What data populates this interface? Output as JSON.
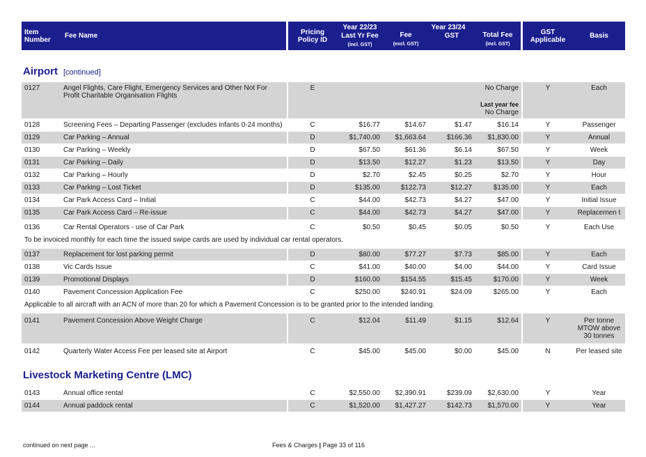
{
  "header": {
    "item_number": "Item Number",
    "fee_name": "Fee Name",
    "pricing_policy": "Pricing Policy ID",
    "year_2223": "Year 22/23",
    "last_yr_fee": "Last Yr Fee",
    "incl_gst_1": "(incl. GST)",
    "year_2324": "Year 23/24",
    "fee": "Fee",
    "excl_gst": "(excl. GST)",
    "gst": "GST",
    "total_fee": "Total Fee",
    "incl_gst_2": "(incl. GST)",
    "gst_applicable": "GST Applicable",
    "basis": "Basis"
  },
  "sections": {
    "airport": {
      "title": "Airport",
      "continued": "[continued]",
      "rows": [
        {
          "item": "0127",
          "name": "Angel Flights, Care Flight, Emergency Services and Other Not For Profit Charitable Organisation Flights",
          "policy": "E",
          "last": "",
          "fee": "",
          "gst": "",
          "total": "No Charge",
          "total_note_label": "Last year fee",
          "total_note_value": "No Charge",
          "applicable": "Y",
          "basis": "Each"
        },
        {
          "item": "0128",
          "name": "Screening Fees – Departing Passenger (excludes infants 0-24 months)",
          "policy": "C",
          "last": "$16.77",
          "fee": "$14.67",
          "gst": "$1.47",
          "total": "$16.14",
          "applicable": "Y",
          "basis": "Passenger"
        },
        {
          "item": "0129",
          "name": "Car Parking – Annual",
          "policy": "D",
          "last": "$1,740.00",
          "fee": "$1,663.64",
          "gst": "$166.36",
          "total": "$1,830.00",
          "applicable": "Y",
          "basis": "Annual"
        },
        {
          "item": "0130",
          "name": "Car Parking – Weekly",
          "policy": "D",
          "last": "$67.50",
          "fee": "$61.36",
          "gst": "$6.14",
          "total": "$67.50",
          "applicable": "Y",
          "basis": "Week"
        },
        {
          "item": "0131",
          "name": "Car Parking – Daily",
          "policy": "D",
          "last": "$13.50",
          "fee": "$12.27",
          "gst": "$1.23",
          "total": "$13.50",
          "applicable": "Y",
          "basis": "Day"
        },
        {
          "item": "0132",
          "name": "Car Parking – Hourly",
          "policy": "D",
          "last": "$2.70",
          "fee": "$2.45",
          "gst": "$0.25",
          "total": "$2.70",
          "applicable": "Y",
          "basis": "Hour"
        },
        {
          "item": "0133",
          "name": "Car Parking – Lost Ticket",
          "policy": "D",
          "last": "$135.00",
          "fee": "$122.73",
          "gst": "$12.27",
          "total": "$135.00",
          "applicable": "Y",
          "basis": "Each"
        },
        {
          "item": "0134",
          "name": "Car Park Access Card – Initial",
          "policy": "C",
          "last": "$44.00",
          "fee": "$42.73",
          "gst": "$4.27",
          "total": "$47.00",
          "applicable": "Y",
          "basis": "Initial Issue"
        },
        {
          "item": "0135",
          "name": "Car Park Access Card – Re-issue",
          "policy": "C",
          "last": "$44.00",
          "fee": "$42.73",
          "gst": "$4.27",
          "total": "$47.00",
          "applicable": "Y",
          "basis": "Replacemen t"
        },
        {
          "item": "0136",
          "name": "Car Rental Operators - use of Car Park",
          "policy": "C",
          "last": "$0.50",
          "fee": "$0.45",
          "gst": "$0.05",
          "total": "$0.50",
          "applicable": "Y",
          "basis": "Each Use"
        },
        {
          "item": "0137",
          "name": "Replacement for lost parking permit",
          "policy": "D",
          "last": "$80.00",
          "fee": "$77.27",
          "gst": "$7.73",
          "total": "$85.00",
          "applicable": "Y",
          "basis": "Each"
        },
        {
          "item": "0138",
          "name": "Vic Cards Issue",
          "policy": "C",
          "last": "$41.00",
          "fee": "$40.00",
          "gst": "$4.00",
          "total": "$44.00",
          "applicable": "Y",
          "basis": "Card Issue"
        },
        {
          "item": "0139",
          "name": "Promotional Displays",
          "policy": "D",
          "last": "$160.00",
          "fee": "$154.55",
          "gst": "$15.45",
          "total": "$170.00",
          "applicable": "Y",
          "basis": "Week"
        },
        {
          "item": "0140",
          "name": "Pavement Concession Application Fee",
          "policy": "C",
          "last": "$250.00",
          "fee": "$240.91",
          "gst": "$24.09",
          "total": "$265.00",
          "applicable": "Y",
          "basis": "Each"
        },
        {
          "item": "0141",
          "name": "Pavement Concession Above Weight Charge",
          "policy": "C",
          "last": "$12.04",
          "fee": "$11.49",
          "gst": "$1.15",
          "total": "$12.64",
          "applicable": "Y",
          "basis": "Per tonne MTOW above 30 tonnes"
        },
        {
          "item": "0142",
          "name": "Quarterly Water Access Fee per leased site at Airport",
          "policy": "C",
          "last": "$45.00",
          "fee": "$45.00",
          "gst": "$0.00",
          "total": "$45.00",
          "applicable": "N",
          "basis": "Per leased site"
        }
      ],
      "note_0136": "To be invoiced monthly for each time the issued swipe cards are used by individual car rental operators.",
      "note_0140": "Applicable to all aircraft with an ACN of more than 20 for which a Pavement Concession is to be granted prior to the intended landing."
    },
    "lmc": {
      "title": "Livestock Marketing Centre (LMC)",
      "rows": [
        {
          "item": "0143",
          "name": "Annual office rental",
          "policy": "C",
          "last": "$2,550.00",
          "fee": "$2,390.91",
          "gst": "$239.09",
          "total": "$2,630.00",
          "applicable": "Y",
          "basis": "Year"
        },
        {
          "item": "0144",
          "name": "Annual paddock rental",
          "policy": "C",
          "last": "$1,520.00",
          "fee": "$1,427.27",
          "gst": "$142.73",
          "total": "$1,570.00",
          "applicable": "Y",
          "basis": "Year"
        }
      ]
    }
  },
  "footer": {
    "continued": "continued on next page ...",
    "doc": "Fees & Charges",
    "page": "Page 33 of 116"
  }
}
